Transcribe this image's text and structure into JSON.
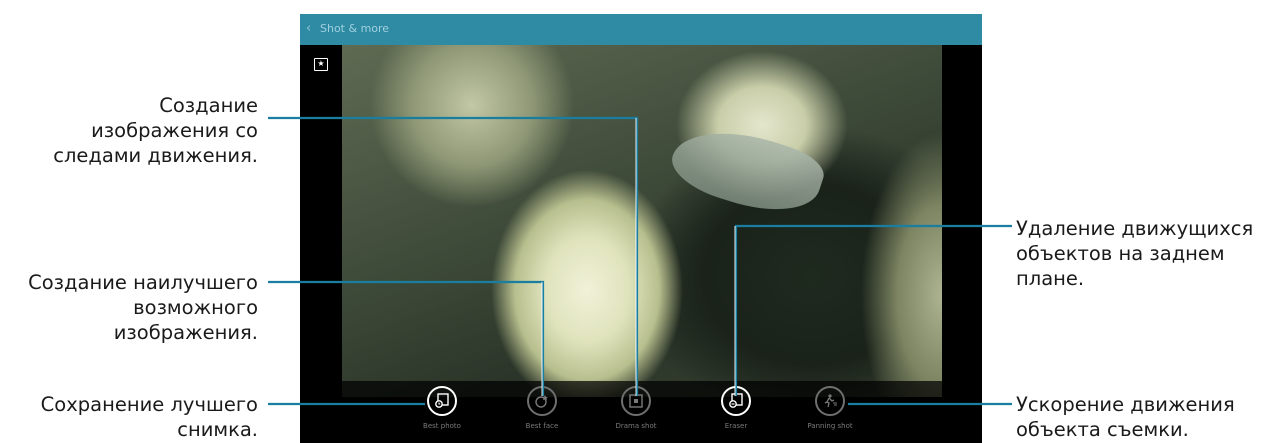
{
  "screen": {
    "title": "Shot & more",
    "back_icon": "chevron-left-icon",
    "gallery_icon": "gallery-star-icon",
    "modes": [
      {
        "label": "Best photo",
        "icon": "best-photo-icon",
        "active": true
      },
      {
        "label": "Best face",
        "icon": "best-face-icon",
        "active": false
      },
      {
        "label": "Drama shot",
        "icon": "drama-shot-icon",
        "active": false
      },
      {
        "label": "Eraser",
        "icon": "eraser-icon",
        "active": true
      },
      {
        "label": "Panning shot",
        "icon": "panning-shot-icon",
        "active": false
      }
    ]
  },
  "callouts": {
    "drama": [
      "Создание",
      "изображения со",
      "следами движения."
    ],
    "best_face": [
      "Создание наилучшего",
      "возможного",
      "изображения."
    ],
    "best_photo": [
      "Сохранение лучшего",
      "снимка."
    ],
    "eraser": [
      "Удаление движущихся",
      "объектов на заднем",
      "плане."
    ],
    "panning": [
      "Ускорение движения",
      "объекта съемки."
    ]
  },
  "colors": {
    "titlebar": "#2f8aa3",
    "leader_line": "#1a7ea1",
    "caption_text": "#1a1a1a"
  }
}
